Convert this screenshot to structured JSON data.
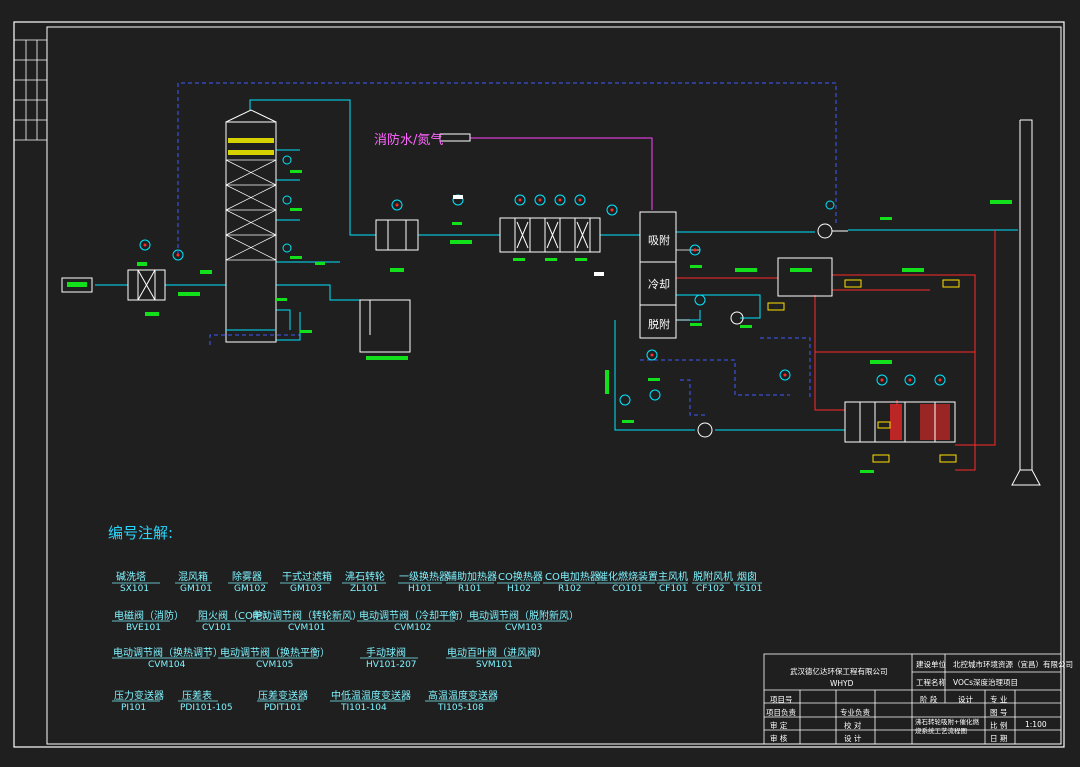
{
  "drawing": {
    "nitrogen_label": "消防水/氮气",
    "tower_sections": [
      "吸附",
      "冷却",
      "脱附"
    ]
  },
  "legend": {
    "title": "编号注解:",
    "rows": [
      [
        {
          "name": "碱洗塔",
          "code": "SX101"
        },
        {
          "name": "混风箱",
          "code": "GM101"
        },
        {
          "name": "除雾器",
          "code": "GM102"
        },
        {
          "name": "干式过滤箱",
          "code": "GM103"
        },
        {
          "name": "沸石转轮",
          "code": "ZL101"
        },
        {
          "name": "一级换热器",
          "code": "H101"
        },
        {
          "name": "辅助加热器",
          "code": "R101"
        },
        {
          "name": "CO换热器",
          "code": "H102"
        },
        {
          "name": "CO电加热器",
          "code": "R102"
        },
        {
          "name": "催化燃烧装置",
          "code": "CO101"
        },
        {
          "name": "主风机",
          "code": "CF101"
        },
        {
          "name": "脱附风机",
          "code": "CF102"
        },
        {
          "name": "烟囱",
          "code": "TS101"
        }
      ],
      [
        {
          "name": "电磁阀（消防）",
          "code": "BVE101"
        },
        {
          "name": "阻火阀（CO炉）",
          "code": "CV101"
        },
        {
          "name": "电动调节阀（转轮新风）",
          "code": "CVM101"
        },
        {
          "name": "电动调节阀（冷却平衡）",
          "code": "CVM102"
        },
        {
          "name": "电动调节阀（脱附新风）",
          "code": "CVM103"
        }
      ],
      [
        {
          "name": "电动调节阀（换热调节）",
          "code": "CVM104"
        },
        {
          "name": "电动调节阀（换热平衡）",
          "code": "CVM105"
        },
        {
          "name": "手动球阀",
          "code": "HV101-207"
        },
        {
          "name": "电动百叶阀（进风阀）",
          "code": "SVM101"
        }
      ],
      [
        {
          "name": "压力变送器",
          "code": "PI101"
        },
        {
          "name": "压差表",
          "code": "PDI101-105"
        },
        {
          "name": "压差变送器",
          "code": "PDIT101"
        },
        {
          "name": "中低温温度变送器",
          "code": "TI101-104"
        },
        {
          "name": "高温温度变送器",
          "code": "TI105-108"
        }
      ]
    ]
  },
  "title_block": {
    "company": "武汉德亿达环保工程有限公司",
    "company_en": "WHYD",
    "client_label": "建设单位",
    "client_value": "北控城市环境资源（宜昌）有限公司",
    "project_label": "工程名称",
    "project_value": "VOCs深度治理项目",
    "stage_label": "阶  段",
    "stage_value": "设计",
    "specialty_label": "专  业",
    "item_label": "项目号",
    "drawing_no_label": "图  号",
    "project_lead_label": "项目负责",
    "specialty_lead_label": "专业负责",
    "review_label": "审  定",
    "check_label": "校  对",
    "audit_label": "审  核",
    "design_label": "设  计",
    "drawing_title": "沸石转轮吸附+催化燃烧系统工艺流程图",
    "scale_label": "比  例",
    "scale_value": "1:100",
    "date_label": "日  期"
  },
  "colors": {
    "background": "#1f1f1f",
    "frame": "#ffffff",
    "process": "#00e5ff",
    "dashed": "#3f5bff",
    "hot_line": "#ff2a2a",
    "gas_line": "#ff44ff",
    "tag_green": "#11e01b",
    "tag_yellow": "#ffe100"
  }
}
